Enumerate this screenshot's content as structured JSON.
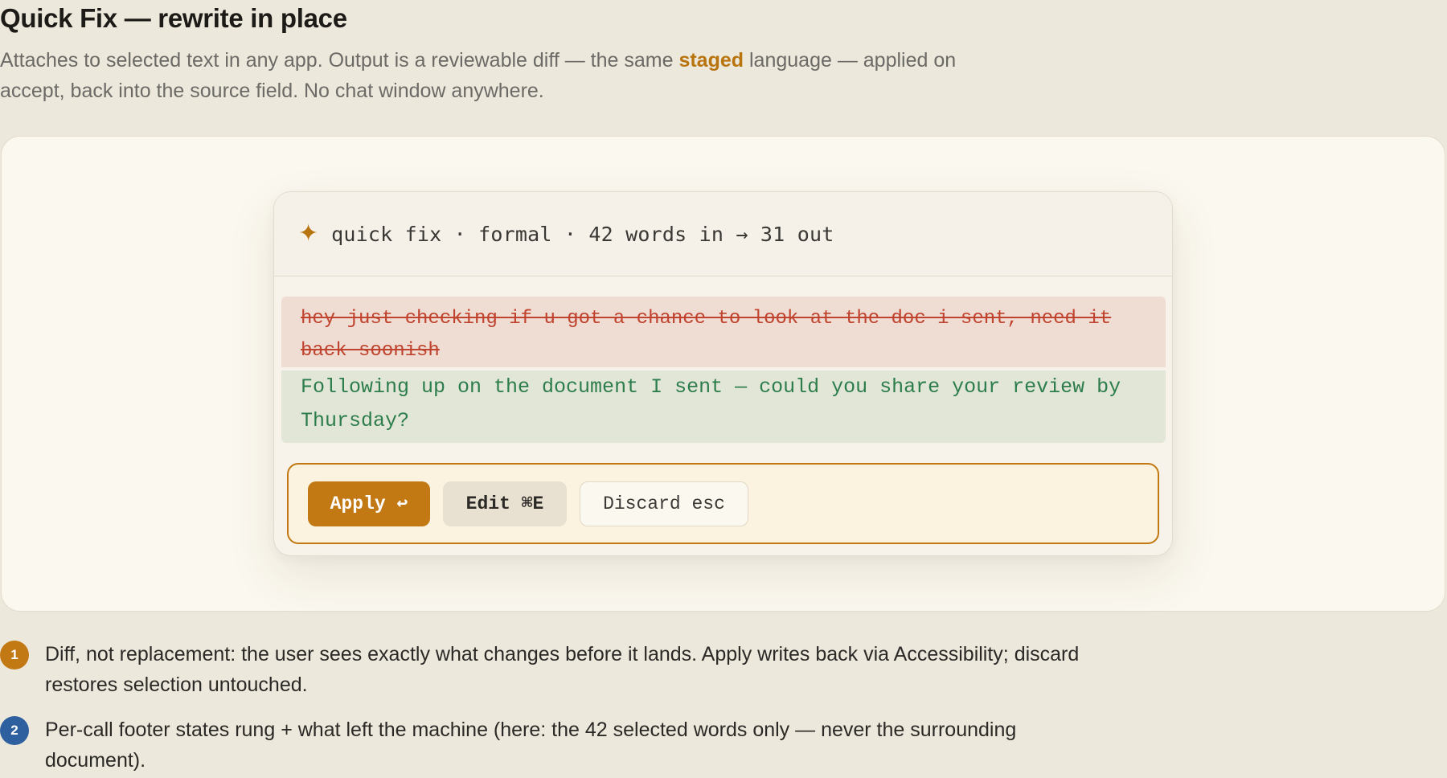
{
  "header": {
    "title": "Quick Fix — rewrite in place",
    "subtitle_before": "Attaches to selected text in any app. Output is a reviewable diff — the same ",
    "subtitle_accent": "staged",
    "subtitle_after": " language — applied on accept, back into the source field. No chat window anywhere."
  },
  "card": {
    "icon": "sparkle-icon",
    "meta": "quick fix · formal · 42 words in → 31 out",
    "removed_text": "hey just checking if u got a chance to look at the doc i sent, need it back soonish",
    "added_text": "Following up on the document I sent — could you share your review by Thursday?",
    "actions": {
      "apply": "Apply ↩",
      "edit": "Edit ⌘E",
      "discard": "Discard esc"
    }
  },
  "notes": [
    {
      "number": "1",
      "text": "Diff, not replacement: the user sees exactly what changes before it lands. Apply writes back via Accessibility; discard restores selection untouched."
    },
    {
      "number": "2",
      "text": "Per-call footer states rung + what left the machine (here: the 42 selected words only — never the surrounding document)."
    }
  ],
  "colors": {
    "accent": "#c27913",
    "removed": "#c0432f",
    "added": "#2d7d4c",
    "note_badge_2": "#2e5f9e"
  }
}
